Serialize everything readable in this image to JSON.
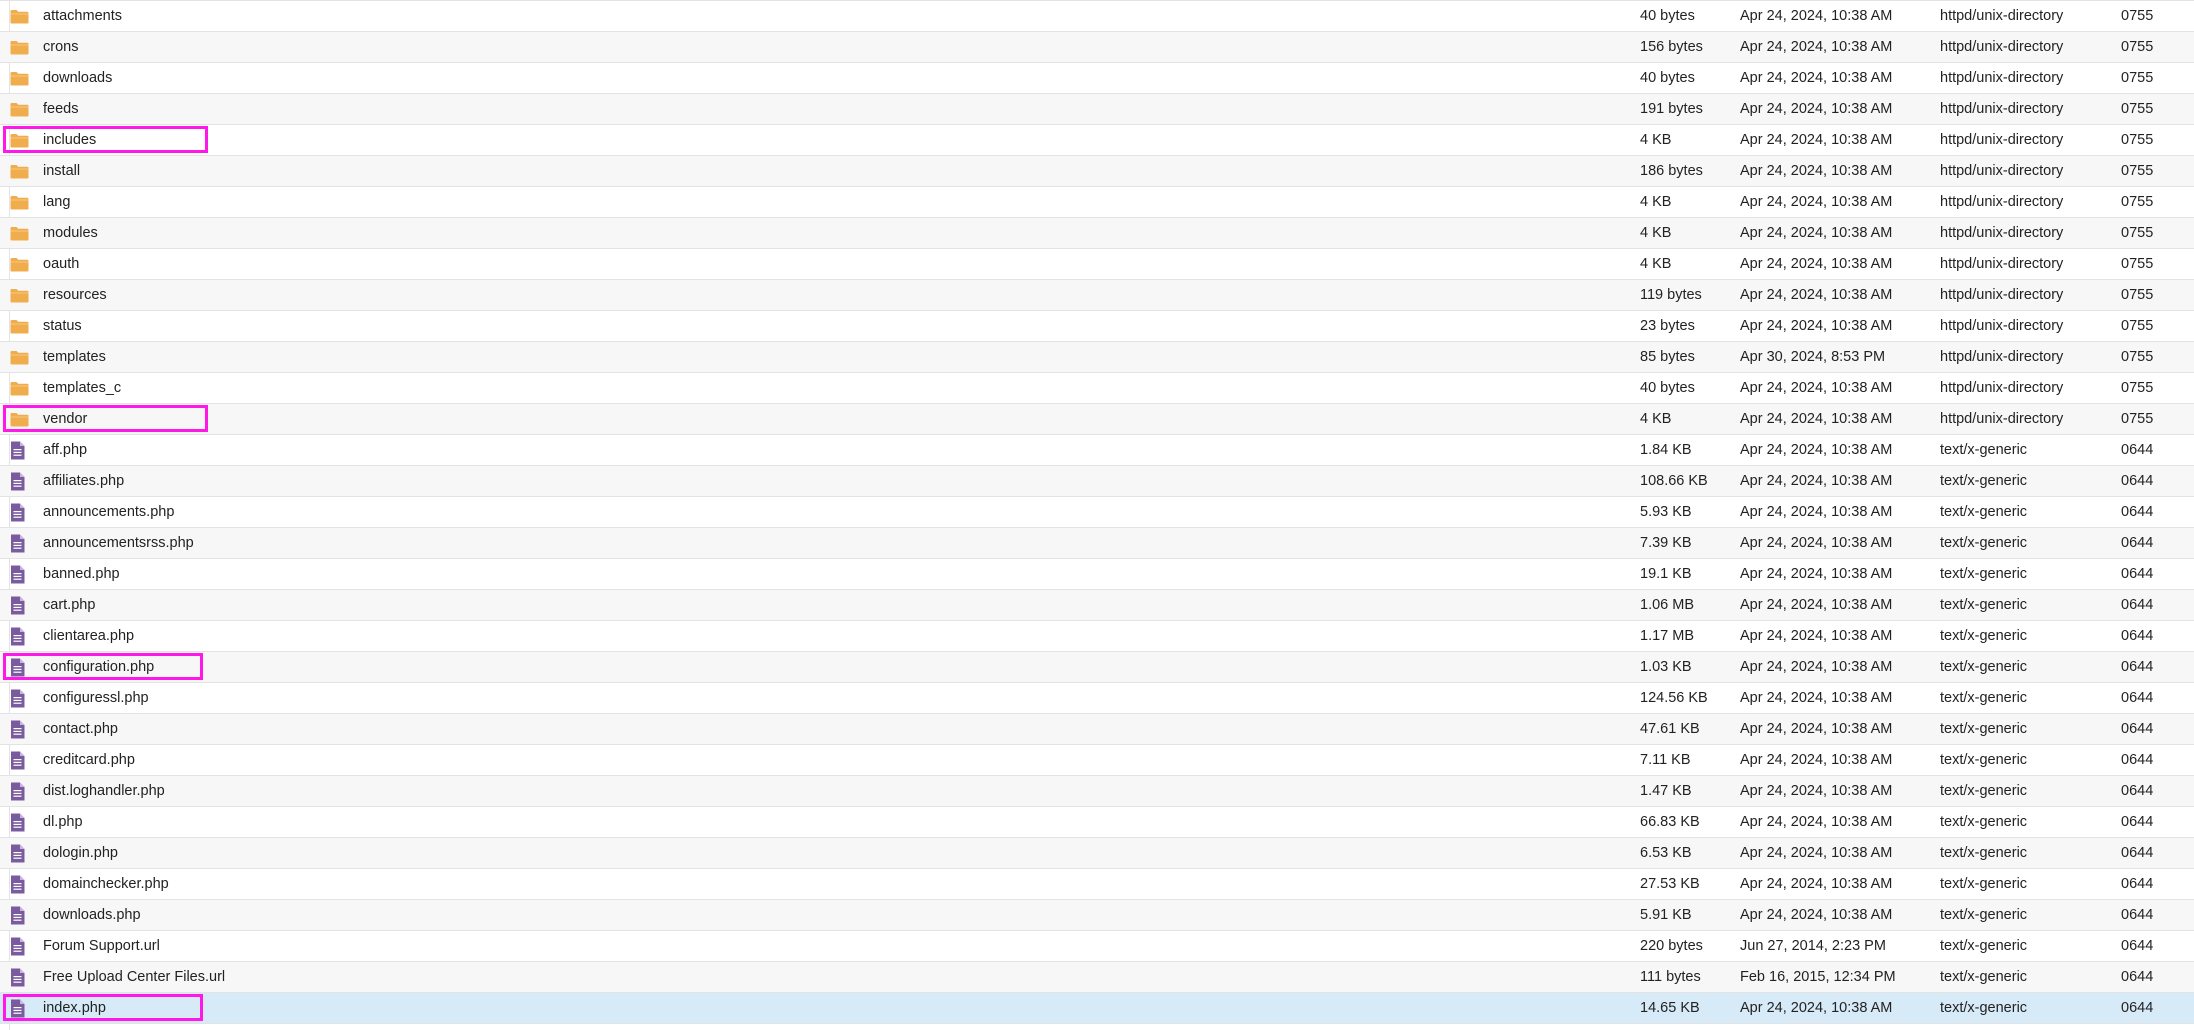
{
  "colors": {
    "folder_icon": "#f0ad4e",
    "file_icon": "#7a5c9e",
    "highlight_border": "#ff19e8",
    "selected_row": "#d7eaf8"
  },
  "files": [
    {
      "name": "attachments",
      "size": "40 bytes",
      "modified": "Apr 24, 2024, 10:38 AM",
      "type": "httpd/unix-directory",
      "perms": "0755",
      "icon": "folder-icon"
    },
    {
      "name": "crons",
      "size": "156 bytes",
      "modified": "Apr 24, 2024, 10:38 AM",
      "type": "httpd/unix-directory",
      "perms": "0755",
      "icon": "folder-icon"
    },
    {
      "name": "downloads",
      "size": "40 bytes",
      "modified": "Apr 24, 2024, 10:38 AM",
      "type": "httpd/unix-directory",
      "perms": "0755",
      "icon": "folder-icon"
    },
    {
      "name": "feeds",
      "size": "191 bytes",
      "modified": "Apr 24, 2024, 10:38 AM",
      "type": "httpd/unix-directory",
      "perms": "0755",
      "icon": "folder-icon"
    },
    {
      "name": "includes",
      "size": "4 KB",
      "modified": "Apr 24, 2024, 10:38 AM",
      "type": "httpd/unix-directory",
      "perms": "0755",
      "icon": "folder-icon",
      "highlighted": true
    },
    {
      "name": "install",
      "size": "186 bytes",
      "modified": "Apr 24, 2024, 10:38 AM",
      "type": "httpd/unix-directory",
      "perms": "0755",
      "icon": "folder-icon"
    },
    {
      "name": "lang",
      "size": "4 KB",
      "modified": "Apr 24, 2024, 10:38 AM",
      "type": "httpd/unix-directory",
      "perms": "0755",
      "icon": "folder-icon"
    },
    {
      "name": "modules",
      "size": "4 KB",
      "modified": "Apr 24, 2024, 10:38 AM",
      "type": "httpd/unix-directory",
      "perms": "0755",
      "icon": "folder-icon"
    },
    {
      "name": "oauth",
      "size": "4 KB",
      "modified": "Apr 24, 2024, 10:38 AM",
      "type": "httpd/unix-directory",
      "perms": "0755",
      "icon": "folder-icon"
    },
    {
      "name": "resources",
      "size": "119 bytes",
      "modified": "Apr 24, 2024, 10:38 AM",
      "type": "httpd/unix-directory",
      "perms": "0755",
      "icon": "folder-icon"
    },
    {
      "name": "status",
      "size": "23 bytes",
      "modified": "Apr 24, 2024, 10:38 AM",
      "type": "httpd/unix-directory",
      "perms": "0755",
      "icon": "folder-icon"
    },
    {
      "name": "templates",
      "size": "85 bytes",
      "modified": "Apr 30, 2024, 8:53 PM",
      "type": "httpd/unix-directory",
      "perms": "0755",
      "icon": "folder-icon"
    },
    {
      "name": "templates_c",
      "size": "40 bytes",
      "modified": "Apr 24, 2024, 10:38 AM",
      "type": "httpd/unix-directory",
      "perms": "0755",
      "icon": "folder-icon"
    },
    {
      "name": "vendor",
      "size": "4 KB",
      "modified": "Apr 24, 2024, 10:38 AM",
      "type": "httpd/unix-directory",
      "perms": "0755",
      "icon": "folder-icon",
      "highlighted": true
    },
    {
      "name": "aff.php",
      "size": "1.84 KB",
      "modified": "Apr 24, 2024, 10:38 AM",
      "type": "text/x-generic",
      "perms": "0644",
      "icon": "file-icon"
    },
    {
      "name": "affiliates.php",
      "size": "108.66 KB",
      "modified": "Apr 24, 2024, 10:38 AM",
      "type": "text/x-generic",
      "perms": "0644",
      "icon": "file-icon"
    },
    {
      "name": "announcements.php",
      "size": "5.93 KB",
      "modified": "Apr 24, 2024, 10:38 AM",
      "type": "text/x-generic",
      "perms": "0644",
      "icon": "file-icon"
    },
    {
      "name": "announcementsrss.php",
      "size": "7.39 KB",
      "modified": "Apr 24, 2024, 10:38 AM",
      "type": "text/x-generic",
      "perms": "0644",
      "icon": "file-icon"
    },
    {
      "name": "banned.php",
      "size": "19.1 KB",
      "modified": "Apr 24, 2024, 10:38 AM",
      "type": "text/x-generic",
      "perms": "0644",
      "icon": "file-icon"
    },
    {
      "name": "cart.php",
      "size": "1.06 MB",
      "modified": "Apr 24, 2024, 10:38 AM",
      "type": "text/x-generic",
      "perms": "0644",
      "icon": "file-icon"
    },
    {
      "name": "clientarea.php",
      "size": "1.17 MB",
      "modified": "Apr 24, 2024, 10:38 AM",
      "type": "text/x-generic",
      "perms": "0644",
      "icon": "file-icon"
    },
    {
      "name": "configuration.php",
      "size": "1.03 KB",
      "modified": "Apr 24, 2024, 10:38 AM",
      "type": "text/x-generic",
      "perms": "0644",
      "icon": "file-icon",
      "highlighted": true
    },
    {
      "name": "configuressl.php",
      "size": "124.56 KB",
      "modified": "Apr 24, 2024, 10:38 AM",
      "type": "text/x-generic",
      "perms": "0644",
      "icon": "file-icon"
    },
    {
      "name": "contact.php",
      "size": "47.61 KB",
      "modified": "Apr 24, 2024, 10:38 AM",
      "type": "text/x-generic",
      "perms": "0644",
      "icon": "file-icon"
    },
    {
      "name": "creditcard.php",
      "size": "7.11 KB",
      "modified": "Apr 24, 2024, 10:38 AM",
      "type": "text/x-generic",
      "perms": "0644",
      "icon": "file-icon"
    },
    {
      "name": "dist.loghandler.php",
      "size": "1.47 KB",
      "modified": "Apr 24, 2024, 10:38 AM",
      "type": "text/x-generic",
      "perms": "0644",
      "icon": "file-icon"
    },
    {
      "name": "dl.php",
      "size": "66.83 KB",
      "modified": "Apr 24, 2024, 10:38 AM",
      "type": "text/x-generic",
      "perms": "0644",
      "icon": "file-icon"
    },
    {
      "name": "dologin.php",
      "size": "6.53 KB",
      "modified": "Apr 24, 2024, 10:38 AM",
      "type": "text/x-generic",
      "perms": "0644",
      "icon": "file-icon"
    },
    {
      "name": "domainchecker.php",
      "size": "27.53 KB",
      "modified": "Apr 24, 2024, 10:38 AM",
      "type": "text/x-generic",
      "perms": "0644",
      "icon": "file-icon"
    },
    {
      "name": "downloads.php",
      "size": "5.91 KB",
      "modified": "Apr 24, 2024, 10:38 AM",
      "type": "text/x-generic",
      "perms": "0644",
      "icon": "file-icon"
    },
    {
      "name": "Forum Support.url",
      "size": "220 bytes",
      "modified": "Jun 27, 2014, 2:23 PM",
      "type": "text/x-generic",
      "perms": "0644",
      "icon": "file-icon"
    },
    {
      "name": "Free Upload Center Files.url",
      "size": "111 bytes",
      "modified": "Feb 16, 2015, 12:34 PM",
      "type": "text/x-generic",
      "perms": "0644",
      "icon": "file-icon"
    },
    {
      "name": "index.php",
      "size": "14.65 KB",
      "modified": "Apr 24, 2024, 10:38 AM",
      "type": "text/x-generic",
      "perms": "0644",
      "icon": "file-icon",
      "highlighted": true,
      "selected": true
    }
  ]
}
